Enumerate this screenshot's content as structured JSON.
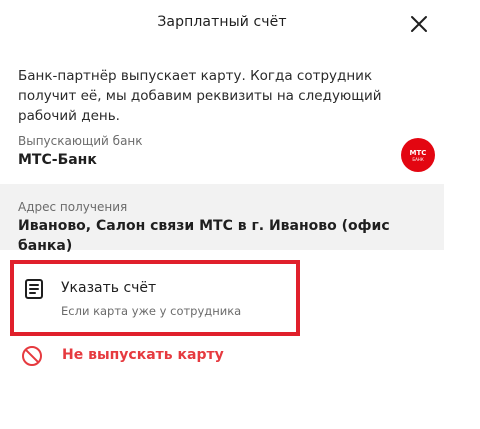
{
  "header": {
    "title": "Зарплатный счёт"
  },
  "info_text": "Банк-партнёр выпускает карту. Когда сотрудник получит её, мы добавим реквизиты на следующий рабочий день.",
  "bank": {
    "label": "Выпускающий банк",
    "value": "МТС-Банк",
    "logo": {
      "line1": "МТС",
      "line2": "БАНК",
      "color": "#e30611"
    }
  },
  "address": {
    "label": "Адрес получения",
    "value": "Иваново, Салон связи МТС в г. Иваново (офис банка)"
  },
  "option_specify": {
    "icon": "document-icon",
    "title": "Указать счёт",
    "subtitle": "Если карта уже у сотрудника",
    "highlight_color": "#e0202b"
  },
  "option_no_issue": {
    "icon": "ban-icon",
    "label": "Не выпускать карту",
    "color": "#e63a3f"
  }
}
